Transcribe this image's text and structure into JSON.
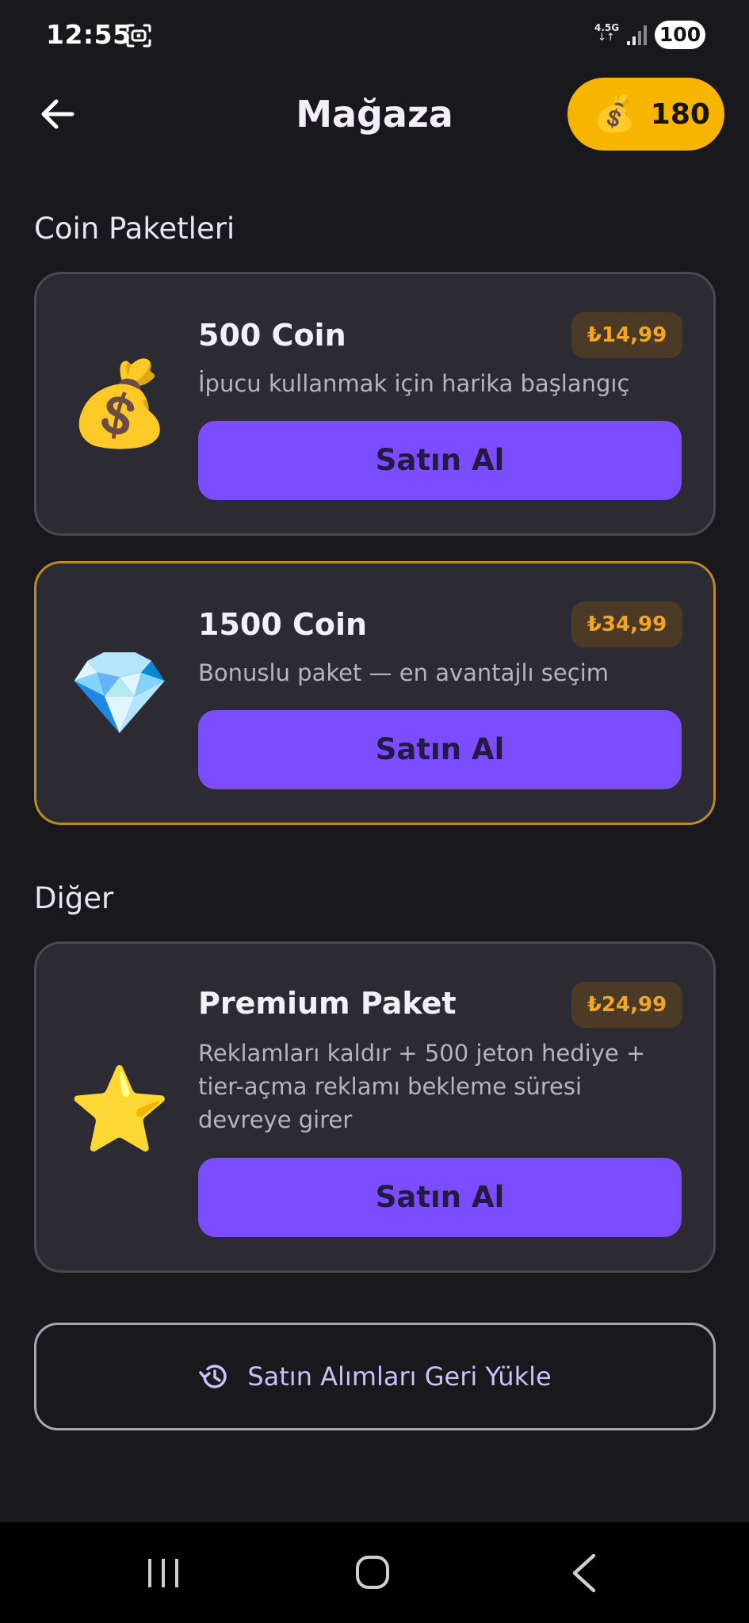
{
  "status_bar": {
    "time": "12:55",
    "network": "4.5G",
    "network_arrows": "↓↑",
    "battery": "100"
  },
  "header": {
    "title": "Mağaza",
    "coin_icon": "💰",
    "coin_balance": "180"
  },
  "sections": {
    "coin_packs_title": "Coin Paketleri",
    "other_title": "Diğer"
  },
  "products": [
    {
      "icon": "💰",
      "icon_name": "money-bag-icon",
      "title": "500 Coin",
      "price": "₺14,99",
      "description_lines": [
        "İpucu kullanmak için harika başlangıç"
      ],
      "buy_label": "Satın Al",
      "highlighted": false
    },
    {
      "icon": "💎",
      "icon_name": "gem-icon",
      "title": "1500 Coin",
      "price": "₺34,99",
      "description_lines": [
        "Bonuslu paket — en avantajlı seçim"
      ],
      "buy_label": "Satın Al",
      "highlighted": true
    },
    {
      "icon": "⭐",
      "icon_name": "star-icon",
      "title": "Premium Paket",
      "price": "₺24,99",
      "description_lines": [
        "Reklamları kaldır + 500 jeton hediye +",
        "tier-açma reklamı bekleme süresi",
        "devreye girer"
      ],
      "buy_label": "Satın Al",
      "highlighted": false
    }
  ],
  "restore": {
    "label": "Satın Alımları Geri Yükle"
  },
  "colors": {
    "background": "#19181d",
    "card": "#2c2a32",
    "accent_purple": "#7c4dff",
    "coin_gold": "#f7b500",
    "price_text": "#f2a623",
    "highlight_border": "#b98a26"
  }
}
